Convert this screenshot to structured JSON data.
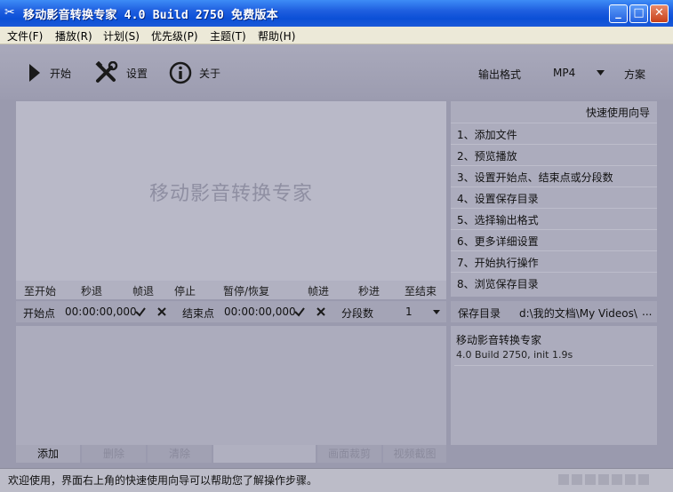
{
  "window": {
    "title": "移动影音转换专家 4.0 Build 2750 免费版本",
    "minimize_glyph": "_",
    "maximize_glyph": "□",
    "close_glyph": "✕",
    "app_icon": "scissors-icon"
  },
  "menu": [
    {
      "label": "文件(F)"
    },
    {
      "label": "播放(R)"
    },
    {
      "label": "计划(S)"
    },
    {
      "label": "优先级(P)"
    },
    {
      "label": "主题(T)"
    },
    {
      "label": "帮助(H)"
    }
  ],
  "toolbar": {
    "start_label": "开始",
    "settings_label": "设置",
    "about_label": "关于",
    "output_format_label": "输出格式",
    "output_format_value": "MP4",
    "scheme_label": "方案",
    "icons": {
      "start": "play-icon",
      "settings": "tools-icon",
      "about": "info-icon",
      "dropdown": "triangle-down-icon"
    }
  },
  "preview": {
    "watermark": "移动影音转换专家"
  },
  "controls": [
    {
      "label": "至开始"
    },
    {
      "label": "秒退"
    },
    {
      "label": "帧退"
    },
    {
      "label": "停止"
    },
    {
      "label": "暂停/恢复"
    },
    {
      "label": "帧进"
    },
    {
      "label": "秒进"
    },
    {
      "label": "至结束"
    }
  ],
  "trim": {
    "start_label": "开始点",
    "start_time": "00:00:00,000",
    "end_label": "结束点",
    "end_time": "00:00:00,000",
    "segments_label": "分段数",
    "segments_value": "1"
  },
  "bottom_buttons": {
    "add": "添加",
    "delete": "删除",
    "clear": "清除",
    "crop": "画面裁剪",
    "snapshot": "视频截图"
  },
  "guide": {
    "title": "快速使用向导",
    "items": [
      {
        "label": "1、添加文件"
      },
      {
        "label": "2、预览播放"
      },
      {
        "label": "3、设置开始点、结束点或分段数"
      },
      {
        "label": "4、设置保存目录"
      },
      {
        "label": "5、选择输出格式"
      },
      {
        "label": "6、更多详细设置"
      },
      {
        "label": "7、开始执行操作"
      },
      {
        "label": "8、浏览保存目录"
      }
    ]
  },
  "save": {
    "label": "保存目录",
    "path": "d:\\我的文档\\My Videos\\",
    "browse": "..."
  },
  "info": {
    "product": "移动影音转换专家",
    "version": "4.0 Build 2750, init 1.9s"
  },
  "status": {
    "message": "欢迎使用，界面右上角的快速使用向导可以帮助您了解操作步骤。"
  },
  "colors": {
    "titlebar": "#1f5fe0",
    "body": "#9a9aae",
    "panel": "#acacbd"
  }
}
